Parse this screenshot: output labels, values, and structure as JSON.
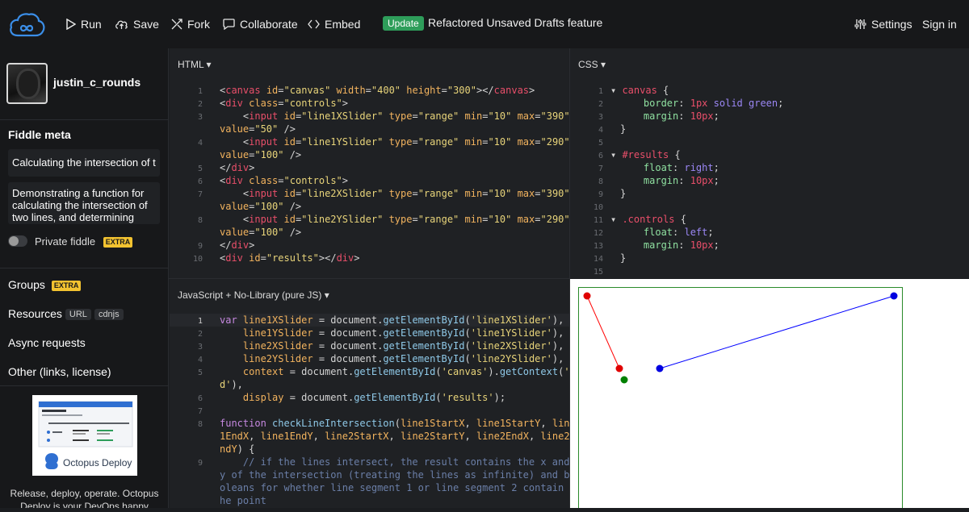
{
  "topbar": {
    "run": "Run",
    "save": "Save",
    "fork": "Fork",
    "collaborate": "Collaborate",
    "embed": "Embed",
    "update_badge": "Update",
    "update_text": "Refactored Unsaved Drafts feature",
    "settings": "Settings",
    "signin": "Sign in"
  },
  "sidebar": {
    "username": "justin_c_rounds",
    "meta_title": "Fiddle meta",
    "title_value": "Calculating the intersection of t",
    "description": "Demonstrating a function for calculating the intersection of two lines, and determining",
    "private": "Private fiddle",
    "extra": "EXTRA",
    "groups": "Groups",
    "resources": "Resources",
    "url_pill": "URL",
    "cdnjs_pill": "cdnjs",
    "async": "Async requests",
    "other": "Other (links, license)",
    "ad_brand": "Octopus Deploy",
    "ad_text_1": "Release, deploy, operate. Octopus",
    "ad_text_2": "Deploy is your DevOps happy"
  },
  "panels": {
    "html": "HTML ▾",
    "css": "CSS ▾",
    "js": "JavaScript + No-Library (pure JS) ▾"
  },
  "colors": {
    "accent_green": "#2e9d5a",
    "extra_yellow": "#f2c230",
    "logo_blue": "#3b8ee8"
  }
}
